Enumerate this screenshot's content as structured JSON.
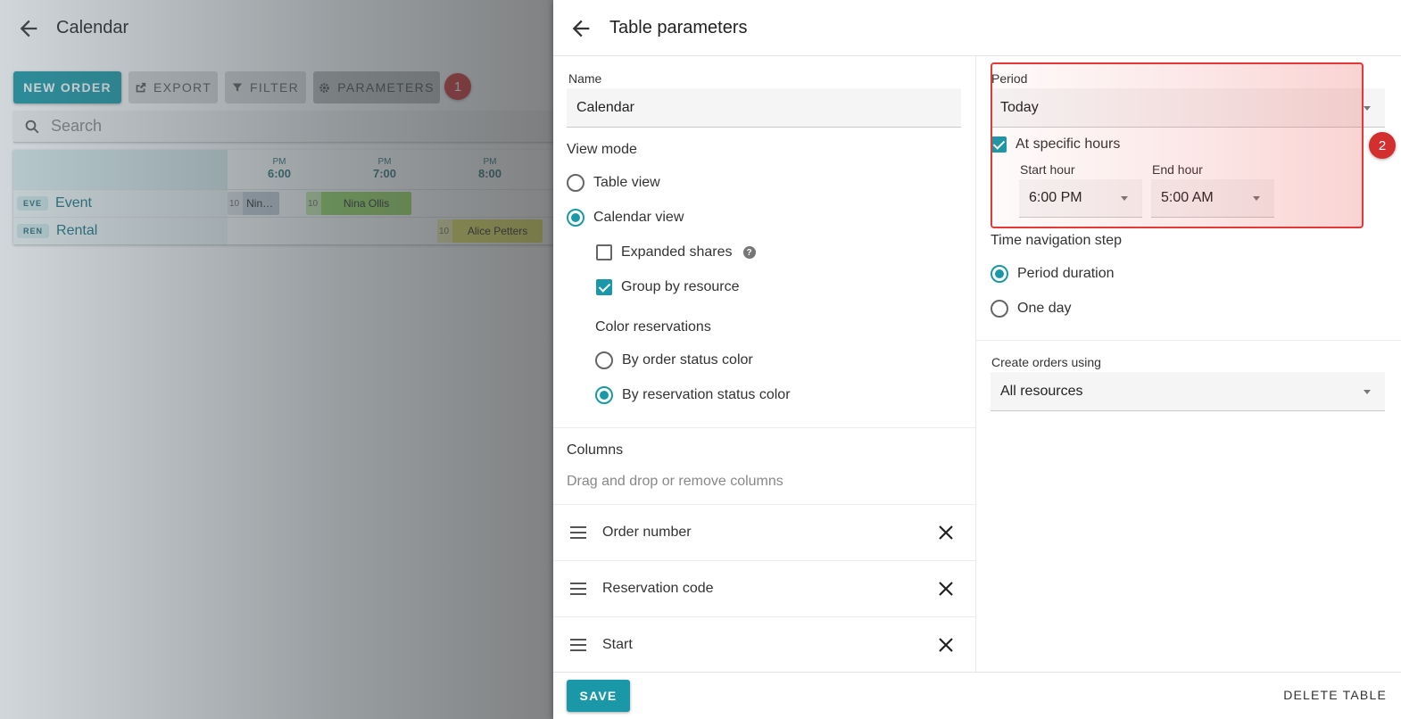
{
  "background": {
    "title": "Calendar",
    "toolbar": {
      "new_order": "NEW ORDER",
      "export": "EXPORT",
      "filter": "FILTER",
      "parameters": "PARAMETERS"
    },
    "step_badge_1": "1",
    "search": {
      "placeholder": "Search"
    },
    "calendar": {
      "hours": [
        {
          "ampm": "PM",
          "hour": "6:00"
        },
        {
          "ampm": "PM",
          "hour": "7:00"
        },
        {
          "ampm": "PM",
          "hour": "8:00"
        }
      ],
      "rows": [
        {
          "code": "EVE",
          "name": "Event"
        },
        {
          "code": "REN",
          "name": "Rental"
        }
      ],
      "reservations": [
        {
          "qty": "10",
          "label": "Nina..."
        },
        {
          "qty": "10",
          "label": "Nina Ollis"
        },
        {
          "qty": "10",
          "label": "Alice Petters"
        }
      ]
    }
  },
  "panel": {
    "title": "Table parameters",
    "name_label": "Name",
    "name_value": "Calendar",
    "view_mode_label": "View mode",
    "view_modes": {
      "table": "Table view",
      "calendar": "Calendar view"
    },
    "expanded_shares": "Expanded shares",
    "group_by_resource": "Group by resource",
    "color_reservations_label": "Color reservations",
    "color_options": {
      "order": "By order status color",
      "reservation": "By reservation status color"
    },
    "columns_label": "Columns",
    "columns_hint": "Drag and drop or remove columns",
    "columns": [
      "Order number",
      "Reservation code",
      "Start"
    ],
    "period_label": "Period",
    "period_value": "Today",
    "at_specific_hours": "At specific hours",
    "start_hour_label": "Start hour",
    "start_hour_value": "6:00 PM",
    "end_hour_label": "End hour",
    "end_hour_value": "5:00 AM",
    "step_badge_2": "2",
    "time_nav_label": "Time navigation step",
    "time_nav": {
      "period": "Period duration",
      "day": "One day"
    },
    "create_orders_label": "Create orders using",
    "create_orders_value": "All resources",
    "save": "SAVE",
    "delete": "DELETE TABLE"
  },
  "colors": {
    "accent": "#1b98a7",
    "badge": "#d32f2f",
    "res_gray": "#bfc9d4",
    "res_green": "#93d65a",
    "res_yellow": "#e4e35b"
  }
}
